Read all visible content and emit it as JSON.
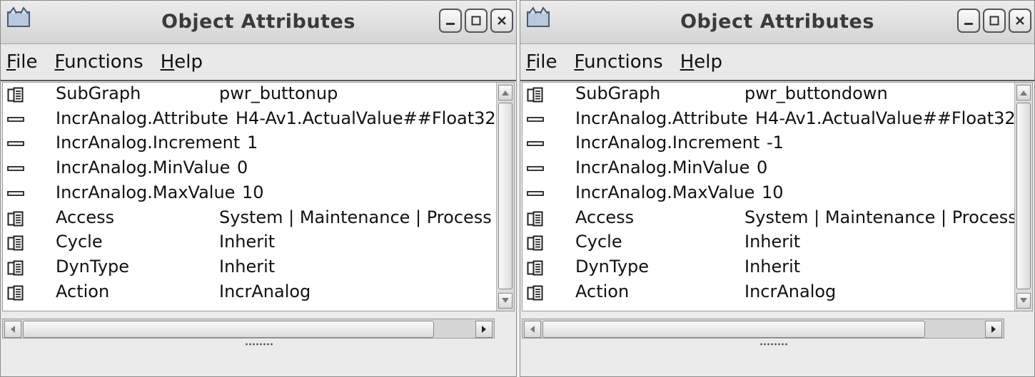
{
  "windows": [
    {
      "title": "Object Attributes",
      "menu": [
        {
          "mnemonic": "F",
          "rest": "ile"
        },
        {
          "mnemonic": "F",
          "rest": "unctions"
        },
        {
          "mnemonic": "H",
          "rest": "elp"
        }
      ],
      "rows": [
        {
          "icon": "folder-icon",
          "name": "SubGraph",
          "value": "pwr_buttonup"
        },
        {
          "icon": "dash-icon",
          "name": "IncrAnalog.Attribute",
          "value": "H4-Av1.ActualValue##Float32"
        },
        {
          "icon": "dash-icon",
          "name": "IncrAnalog.Increment",
          "value": "1"
        },
        {
          "icon": "dash-icon",
          "name": "IncrAnalog.MinValue",
          "value": "0"
        },
        {
          "icon": "dash-icon",
          "name": "IncrAnalog.MaxValue",
          "value": "10"
        },
        {
          "icon": "folder-icon",
          "name": "Access",
          "value": "System | Maintenance | Process"
        },
        {
          "icon": "folder-icon",
          "name": "Cycle",
          "value": "Inherit"
        },
        {
          "icon": "folder-icon",
          "name": "DynType",
          "value": "Inherit"
        },
        {
          "icon": "folder-icon",
          "name": "Action",
          "value": "IncrAnalog"
        }
      ]
    },
    {
      "title": "Object Attributes",
      "menu": [
        {
          "mnemonic": "F",
          "rest": "ile"
        },
        {
          "mnemonic": "F",
          "rest": "unctions"
        },
        {
          "mnemonic": "H",
          "rest": "elp"
        }
      ],
      "rows": [
        {
          "icon": "folder-icon",
          "name": "SubGraph",
          "value": "pwr_buttondown"
        },
        {
          "icon": "dash-icon",
          "name": "IncrAnalog.Attribute",
          "value": "H4-Av1.ActualValue##Float32"
        },
        {
          "icon": "dash-icon",
          "name": "IncrAnalog.Increment",
          "value": "-1"
        },
        {
          "icon": "dash-icon",
          "name": "IncrAnalog.MinValue",
          "value": "0"
        },
        {
          "icon": "dash-icon",
          "name": "IncrAnalog.MaxValue",
          "value": "10"
        },
        {
          "icon": "folder-icon",
          "name": "Access",
          "value": "System | Maintenance | Process"
        },
        {
          "icon": "folder-icon",
          "name": "Cycle",
          "value": "Inherit"
        },
        {
          "icon": "folder-icon",
          "name": "DynType",
          "value": "Inherit"
        },
        {
          "icon": "folder-icon",
          "name": "Action",
          "value": "IncrAnalog"
        }
      ]
    }
  ]
}
